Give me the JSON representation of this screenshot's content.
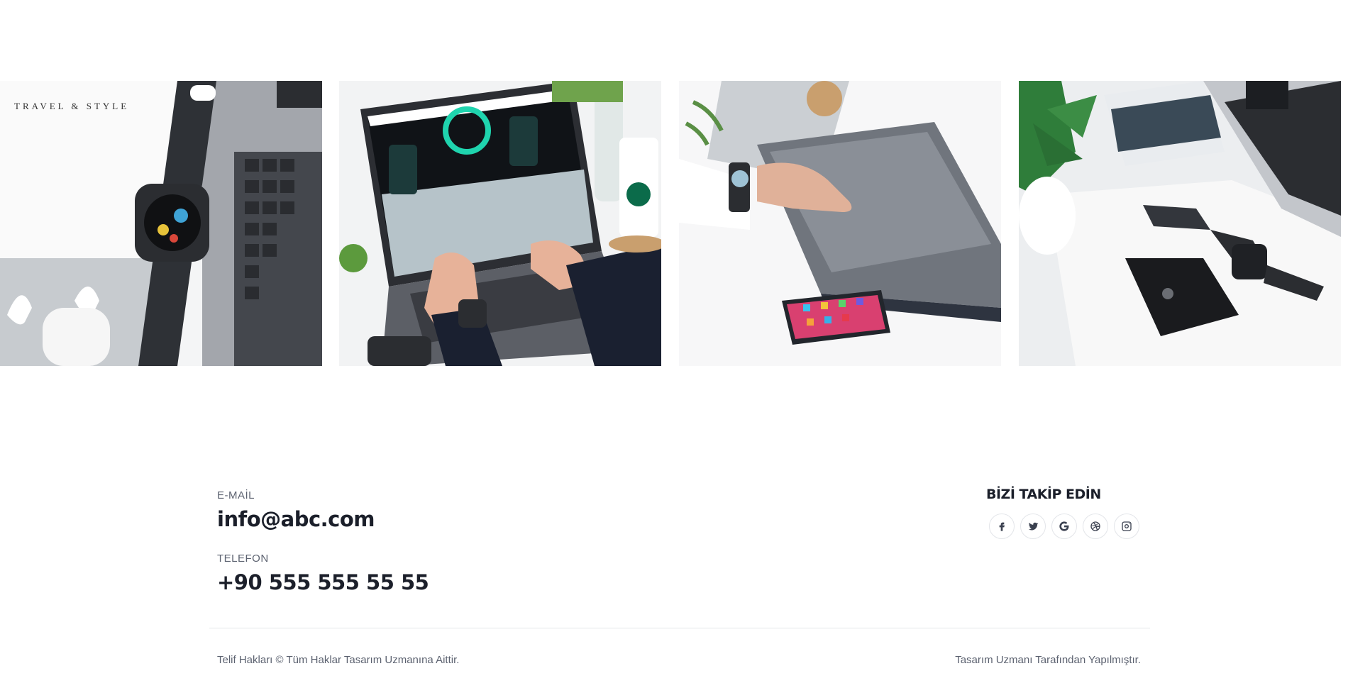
{
  "gallery": {
    "items": [
      {
        "alt": "smartwatch-airpods-laptop"
      },
      {
        "alt": "laptop-typing"
      },
      {
        "alt": "closed-laptop-phone"
      },
      {
        "alt": "phone-watch-laptop"
      }
    ]
  },
  "contact": {
    "email_label": "E-MAİL",
    "email": "info@abc.com",
    "phone_label": "TELEFON",
    "phone": "+90 555 555 55 55"
  },
  "follow": {
    "title": "BİZİ TAKİP EDİN",
    "icons": [
      "facebook-icon",
      "twitter-icon",
      "google-icon",
      "dribbble-icon",
      "instagram-icon"
    ]
  },
  "footer": {
    "copyright": "Telif Hakları © Tüm Haklar Tasarım Uzmanına Aittir.",
    "credit": "Tasarım Uzmanı Tarafından Yapılmıştır."
  },
  "colors": {
    "text_dark": "#1b1f2a",
    "text_muted": "#5c6270",
    "border": "#e4e6ea"
  }
}
